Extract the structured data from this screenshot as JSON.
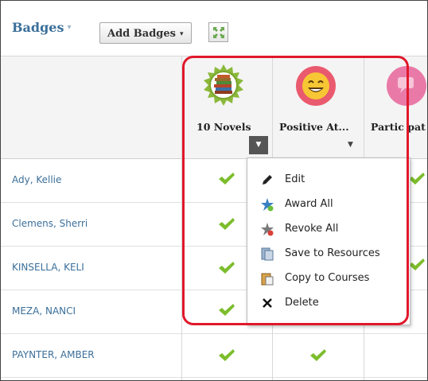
{
  "toolbar": {
    "title": "Badges",
    "title_caret": "▾",
    "add_badges_label": "Add Badges",
    "add_badges_caret": "▾"
  },
  "badges": [
    {
      "name": "10 Novels",
      "icon": "books-badge-icon"
    },
    {
      "name": "Positive At...",
      "icon": "smiley-badge-icon"
    },
    {
      "name": "Partic pat",
      "icon": "speech-bubble-badge-icon"
    }
  ],
  "students": [
    {
      "name": "Ady, Kellie"
    },
    {
      "name": "Clemens, Sherri"
    },
    {
      "name": "KINSELLA, KELI"
    },
    {
      "name": "MEZA, NANCI"
    },
    {
      "name": "PAYNTER, AMBER"
    }
  ],
  "menu": {
    "items": [
      {
        "label": "Edit",
        "icon": "pencil-icon"
      },
      {
        "label": "Award All",
        "icon": "award-star-icon"
      },
      {
        "label": "Revoke All",
        "icon": "revoke-star-icon"
      },
      {
        "label": "Save to Resources",
        "icon": "save-resources-icon"
      },
      {
        "label": "Copy to Courses",
        "icon": "copy-courses-icon"
      },
      {
        "label": "Delete",
        "icon": "delete-x-icon"
      }
    ]
  },
  "colors": {
    "link": "#3b6f9a",
    "check": "#7cbd2c",
    "highlight": "#e1182b",
    "caret_button": "#555555"
  }
}
